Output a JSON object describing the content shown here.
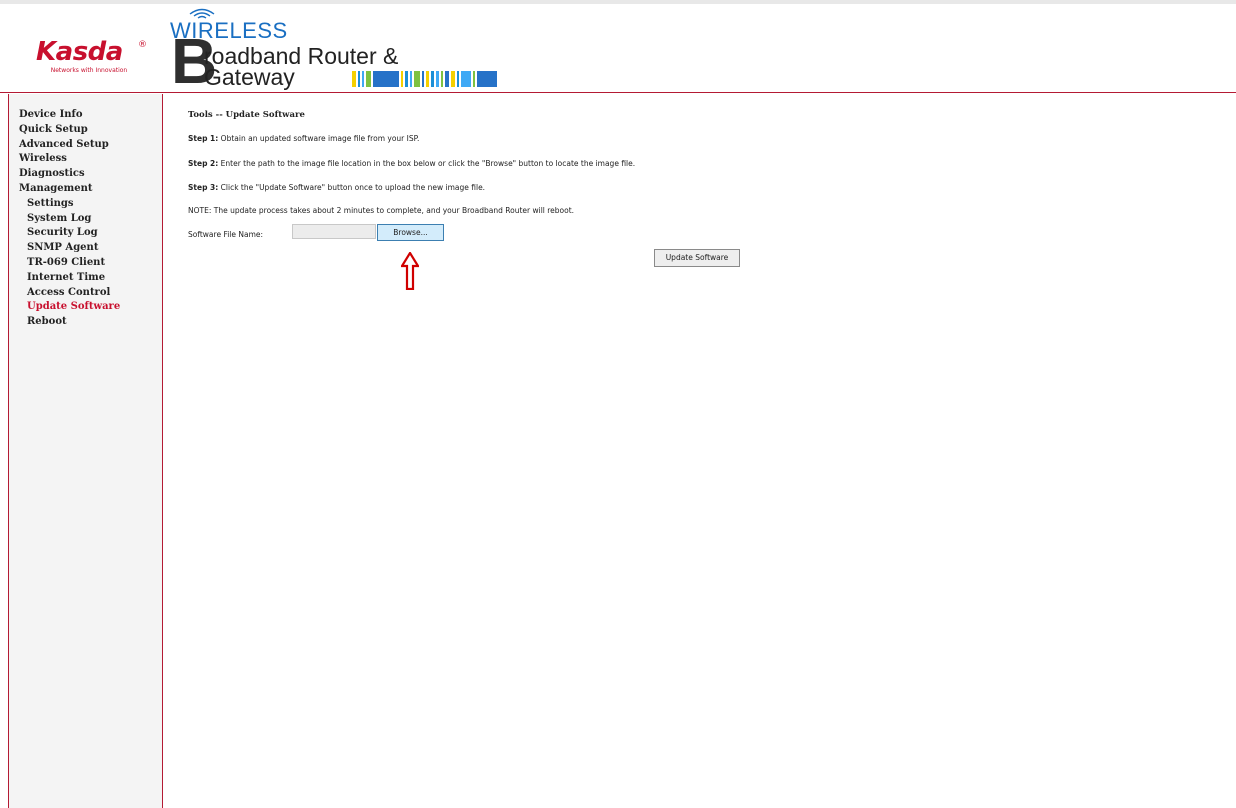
{
  "brand": {
    "logo_text": "Kasda",
    "logo_symbol": "®",
    "tagline": "Networks with Innovation",
    "accent_color": "#c8102e"
  },
  "banner": {
    "wireless": "WIRELESS",
    "big_letter": "B",
    "line1": "roadband Router &",
    "line2": "Gateway",
    "stripe_colors": [
      "#f5d000",
      "#1c8fd6",
      "#3fa9f5",
      "#7ec242",
      "#2672c8"
    ]
  },
  "sidebar": {
    "items": [
      {
        "label": "Device Info",
        "sub": false,
        "active": false
      },
      {
        "label": "Quick Setup",
        "sub": false,
        "active": false
      },
      {
        "label": "Advanced Setup",
        "sub": false,
        "active": false
      },
      {
        "label": "Wireless",
        "sub": false,
        "active": false
      },
      {
        "label": "Diagnostics",
        "sub": false,
        "active": false
      },
      {
        "label": "Management",
        "sub": false,
        "active": false
      },
      {
        "label": "Settings",
        "sub": true,
        "active": false
      },
      {
        "label": "System Log",
        "sub": true,
        "active": false
      },
      {
        "label": "Security Log",
        "sub": true,
        "active": false
      },
      {
        "label": "SNMP Agent",
        "sub": true,
        "active": false
      },
      {
        "label": "TR-069 Client",
        "sub": true,
        "active": false
      },
      {
        "label": "Internet Time",
        "sub": true,
        "active": false
      },
      {
        "label": "Access Control",
        "sub": true,
        "active": false
      },
      {
        "label": "Update Software",
        "sub": true,
        "active": true
      },
      {
        "label": "Reboot",
        "sub": true,
        "active": false
      }
    ]
  },
  "main": {
    "title": "Tools -- Update Software",
    "step1_label": "Step 1:",
    "step1_text": "Obtain an updated software image file from your ISP.",
    "step2_label": "Step 2:",
    "step2_text": "Enter the path to the image file location in the box below or click the \"Browse\" button to locate the image file.",
    "step3_label": "Step 3:",
    "step3_text": "Click the \"Update Software\" button once to upload the new image file.",
    "note": "NOTE: The update process takes about 2 minutes to complete, and your Broadband Router will reboot.",
    "file_label": "Software File Name:",
    "file_value": "",
    "browse_label": "Browse...",
    "update_label": "Update Software",
    "arrow_icon": "up-arrow-outline",
    "arrow_color": "#d00000"
  }
}
